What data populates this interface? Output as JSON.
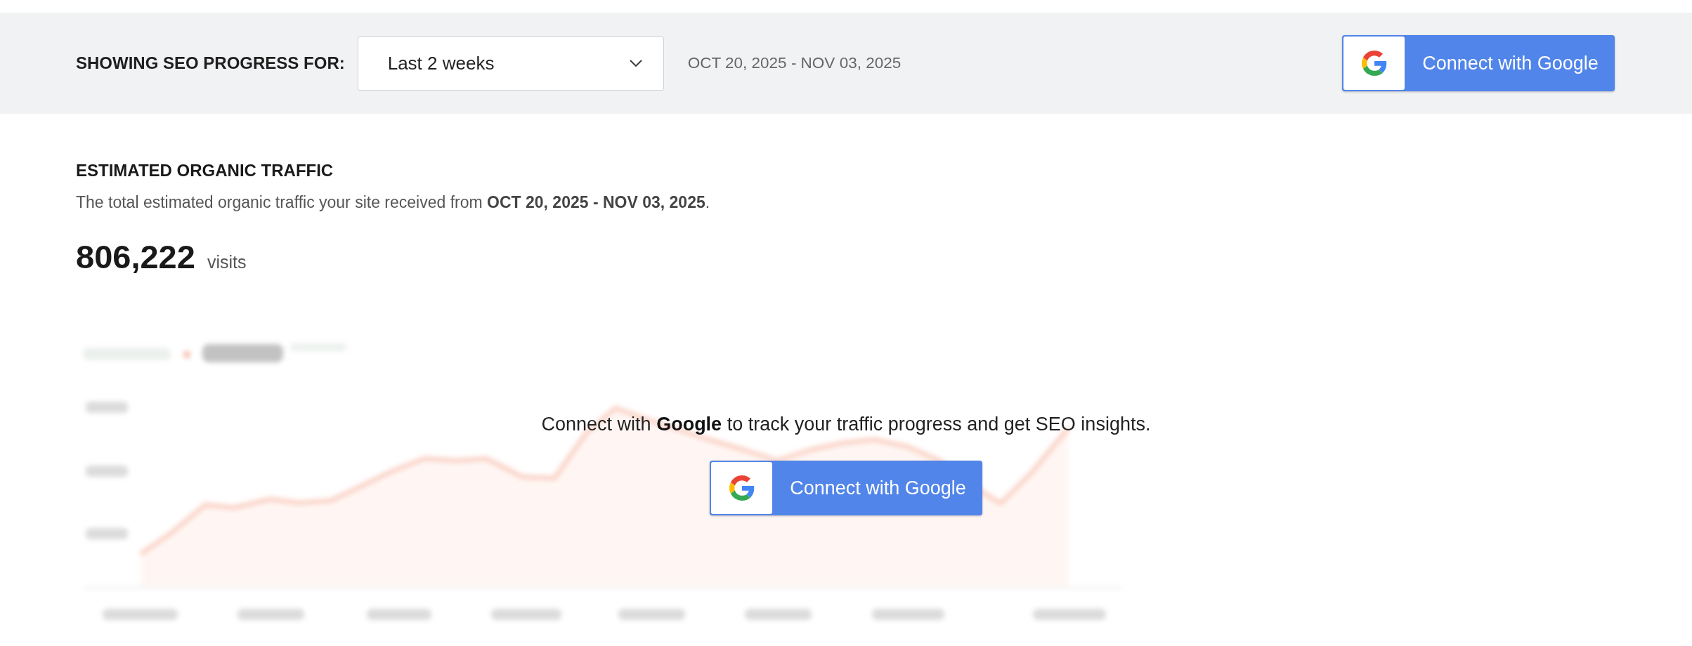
{
  "filter_bar": {
    "label": "SHOWING SEO PROGRESS FOR:",
    "period_dropdown": {
      "value": "Last 2 weeks"
    },
    "date_range": "OCT 20, 2025 - NOV 03, 2025",
    "connect_button": {
      "label": "Connect with Google"
    }
  },
  "traffic": {
    "title": "ESTIMATED ORGANIC TRAFFIC",
    "description": "The total estimated organic traffic your site received from **OCT 20, 2025 - NOV 03, 2025**.",
    "total": "806,222",
    "unit": "visits"
  },
  "connect_overlay": {
    "message": "Connect with **Google** to track your traffic progress and get SEO insights.",
    "button": {
      "label": "Connect with Google"
    }
  }
}
